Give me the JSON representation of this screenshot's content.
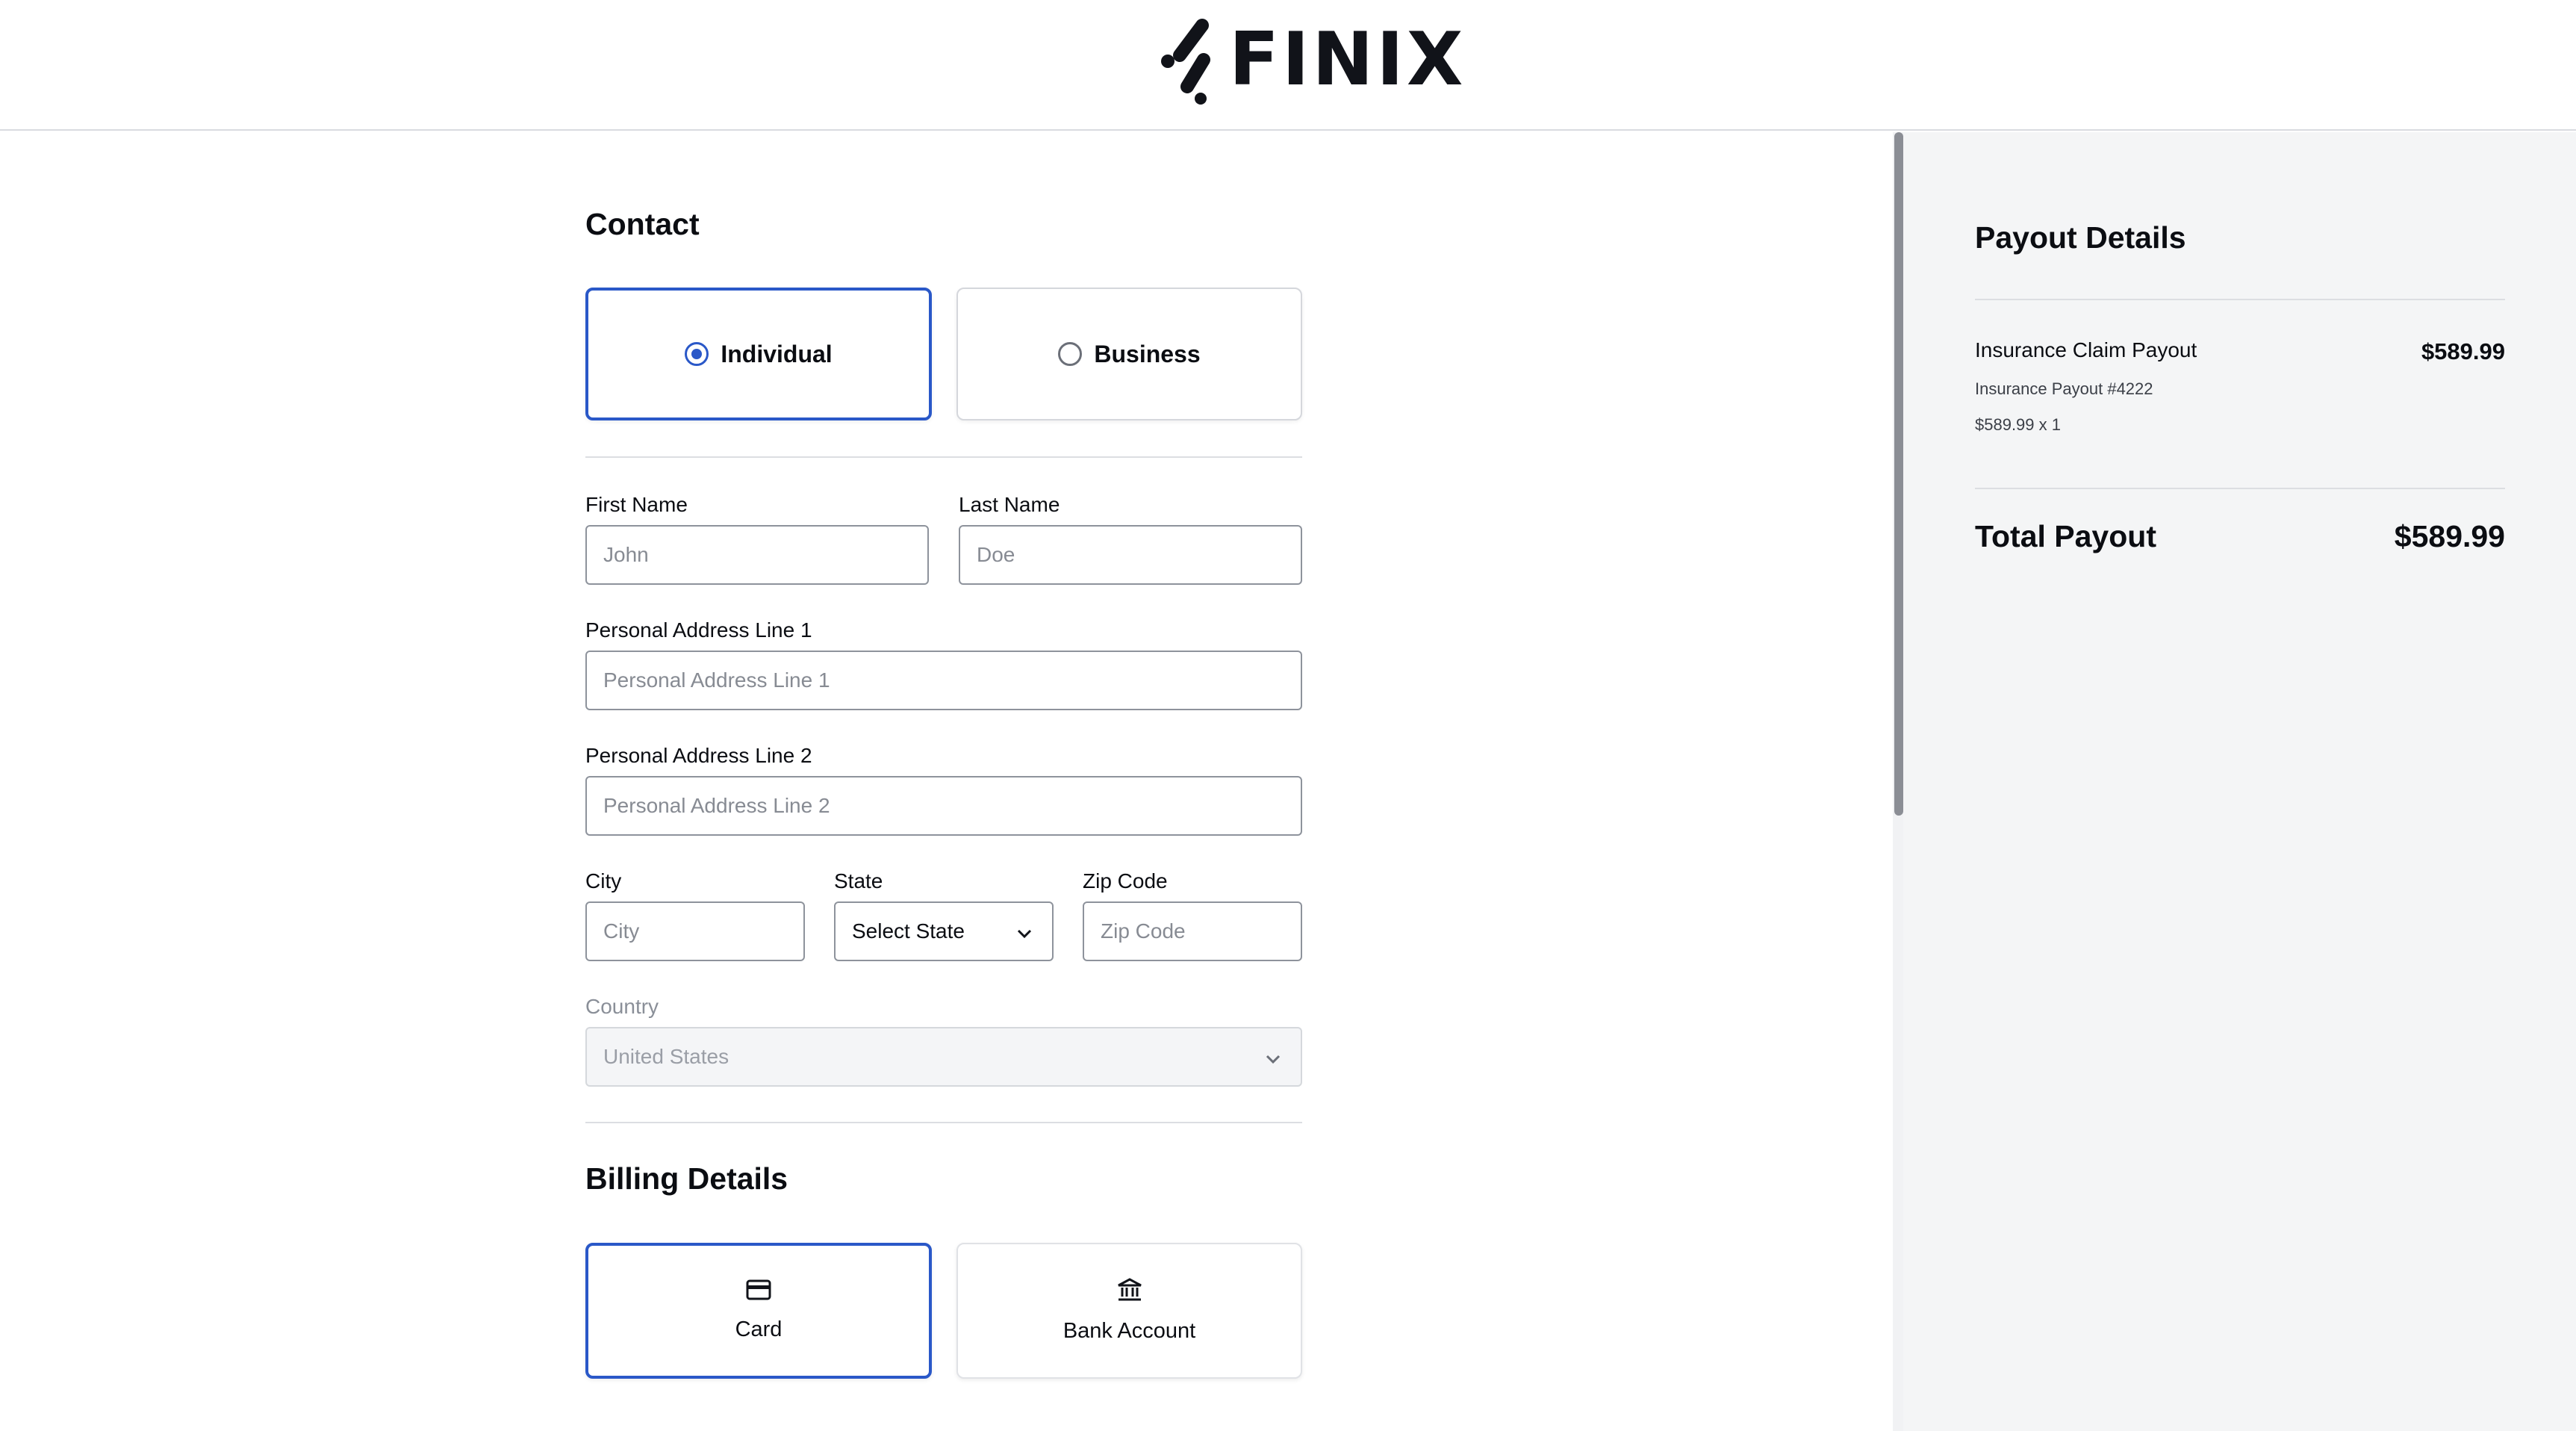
{
  "header": {
    "brand": "FINIX"
  },
  "contact": {
    "title": "Contact",
    "types": [
      {
        "label": "Individual",
        "selected": true
      },
      {
        "label": "Business",
        "selected": false
      }
    ],
    "first_name": {
      "label": "First Name",
      "placeholder": "John"
    },
    "last_name": {
      "label": "Last Name",
      "placeholder": "Doe"
    },
    "address1": {
      "label": "Personal Address Line 1",
      "placeholder": "Personal Address Line 1"
    },
    "address2": {
      "label": "Personal Address Line 2",
      "placeholder": "Personal Address Line 2"
    },
    "city": {
      "label": "City",
      "placeholder": "City"
    },
    "state": {
      "label": "State",
      "value": "Select State"
    },
    "zip": {
      "label": "Zip Code",
      "placeholder": "Zip Code"
    },
    "country": {
      "label": "Country",
      "value": "United States"
    }
  },
  "billing": {
    "title": "Billing Details",
    "options": [
      {
        "label": "Card",
        "icon": "credit-card-icon",
        "selected": true
      },
      {
        "label": "Bank Account",
        "icon": "bank-icon",
        "selected": false
      }
    ]
  },
  "payout": {
    "title": "Payout Details",
    "item": {
      "name": "Insurance Claim Payout",
      "price": "$589.99",
      "reference": "Insurance Payout #4222",
      "quantity_line": "$589.99 x 1"
    },
    "total_label": "Total Payout",
    "total_value": "$589.99"
  },
  "colors": {
    "accent": "#2a58c8",
    "sidebar_bg": "#f4f5f6"
  }
}
